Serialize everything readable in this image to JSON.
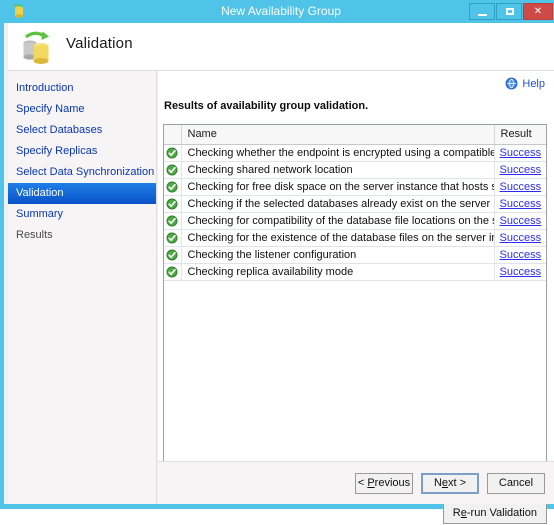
{
  "window": {
    "title": "New Availability Group",
    "titlebar_icon": "availability-group-icon",
    "controls": {
      "minimize": "minimize-icon",
      "maximize": "maximize-icon",
      "close": "✕"
    }
  },
  "header": {
    "title": "Validation",
    "icon": "database-sync-icon"
  },
  "sidebar": {
    "items": [
      {
        "label": "Introduction",
        "state": "link"
      },
      {
        "label": "Specify Name",
        "state": "link"
      },
      {
        "label": "Select Databases",
        "state": "link"
      },
      {
        "label": "Specify Replicas",
        "state": "link"
      },
      {
        "label": "Select Data Synchronization",
        "state": "link"
      },
      {
        "label": "Validation",
        "state": "selected"
      },
      {
        "label": "Summary",
        "state": "link"
      },
      {
        "label": "Results",
        "state": "done"
      }
    ]
  },
  "content": {
    "help_label": "Help",
    "help_icon": "help-globe-icon",
    "results_heading": "Results of availability group validation.",
    "rerun_button": {
      "prefix": "R",
      "accel": "e",
      "suffix": "-run Validation",
      "label": "Re-run Validation"
    }
  },
  "table": {
    "columns": [
      "",
      "Name",
      "Result"
    ],
    "status_icon": "success-check-icon",
    "rows": [
      {
        "name": "Checking whether the endpoint is encrypted using a compatible algorithm",
        "result": "Success",
        "status": "success"
      },
      {
        "name": "Checking shared network location",
        "result": "Success",
        "status": "success"
      },
      {
        "name": "Checking for free disk space on the server instance that hosts secondary re...",
        "result": "Success",
        "status": "success"
      },
      {
        "name": "Checking if the selected databases already exist on the server instance that ...",
        "result": "Success",
        "status": "success"
      },
      {
        "name": "Checking for compatibility of the database file locations on the server inst...",
        "result": "Success",
        "status": "success"
      },
      {
        "name": "Checking for the existence of the database files on the server instance that ...",
        "result": "Success",
        "status": "success"
      },
      {
        "name": "Checking the listener configuration",
        "result": "Success",
        "status": "success"
      },
      {
        "name": "Checking replica availability mode",
        "result": "Success",
        "status": "success"
      }
    ]
  },
  "footer": {
    "previous": {
      "prefix": "< ",
      "accel": "P",
      "suffix": "revious",
      "label": "< Previous"
    },
    "next": {
      "prefix": "N",
      "accel": "e",
      "suffix": "xt >",
      "label": "Next >"
    },
    "cancel": {
      "label": "Cancel"
    }
  },
  "colors": {
    "titlebar": "#4fc3e8",
    "close_button": "#cf4a46",
    "selected_nav": "#0a52c8",
    "link": "#0a36b8",
    "result_link": "#2d2df0",
    "success": "#3f9e3f",
    "panel": "#f6f4f4"
  }
}
